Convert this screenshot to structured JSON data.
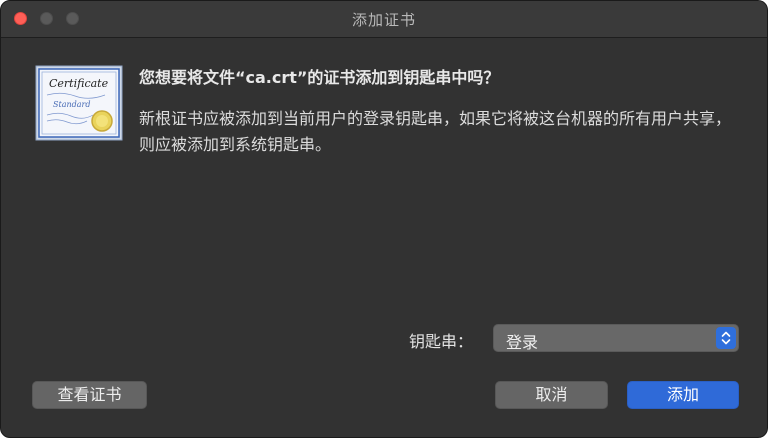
{
  "window": {
    "title": "添加证书"
  },
  "icon": {
    "name": "certificate-icon",
    "text_line1": "Certificate",
    "text_line2": "Standard"
  },
  "dialog": {
    "heading": "您想要将文件“ca.crt”的证书添加到钥匙串中吗？",
    "message": "新根证书应被添加到当前用户的登录钥匙串，如果它将被这台机器的所有用户共享，则应被添加到系统钥匙串。"
  },
  "keychain": {
    "label": "钥匙串：",
    "selected": "登录"
  },
  "buttons": {
    "view_certificate": "查看证书",
    "cancel": "取消",
    "add": "添加"
  },
  "colors": {
    "window_bg": "#323232",
    "accent": "#2f6ad8",
    "close": "#fe5f57"
  }
}
